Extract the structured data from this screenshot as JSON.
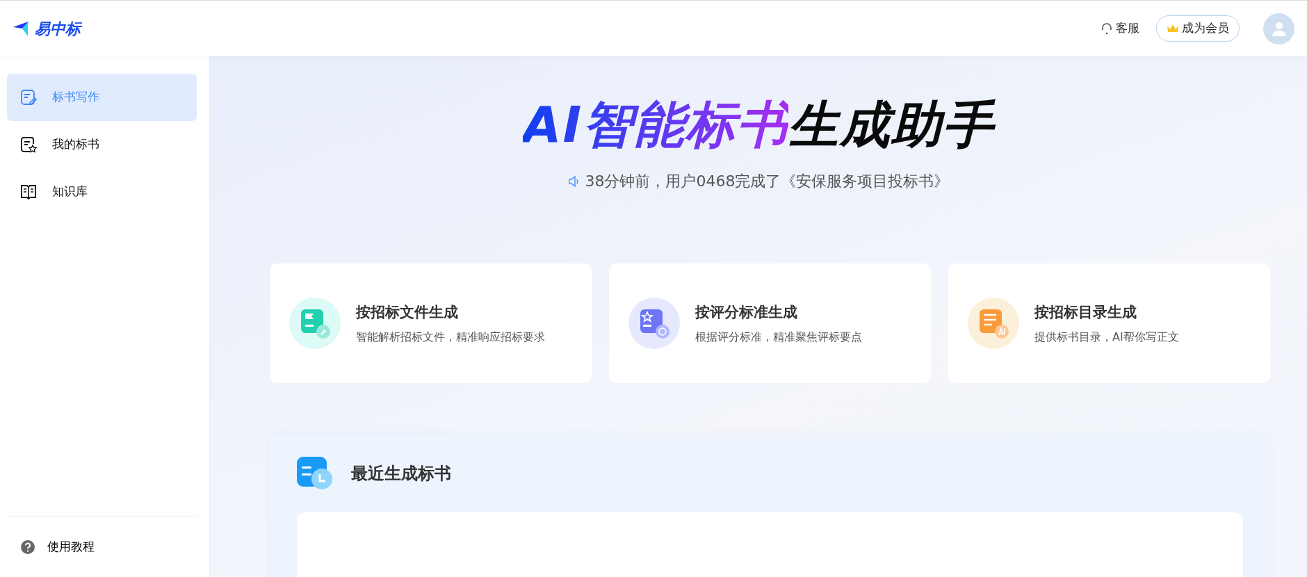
{
  "header": {
    "logo": "易中标",
    "service": "客服",
    "member": "成为会员"
  },
  "sidebar": {
    "items": [
      {
        "label": "标书写作",
        "kind": "write",
        "selected": true
      },
      {
        "label": "我的标书",
        "kind": "star",
        "selected": false
      },
      {
        "label": "知识库",
        "kind": "book",
        "selected": false
      }
    ],
    "footer": "使用教程"
  },
  "hero": {
    "title_highlight": "AI智能标书",
    "title_rest": "生成助手",
    "notice": "38分钟前，用户0468完成了《安保服务项目投标书》"
  },
  "cards": [
    {
      "kind": "file",
      "title": "按招标文件生成",
      "desc": "智能解析招标文件，精准响应招标要求"
    },
    {
      "kind": "score",
      "title": "按评分标准生成",
      "desc": "根据评分标准，精准聚焦评标要点"
    },
    {
      "kind": "catalog",
      "title": "按招标目录生成",
      "desc": "提供标书目录，AI帮你写正文"
    }
  ],
  "recent": {
    "title": "最近生成标书"
  }
}
